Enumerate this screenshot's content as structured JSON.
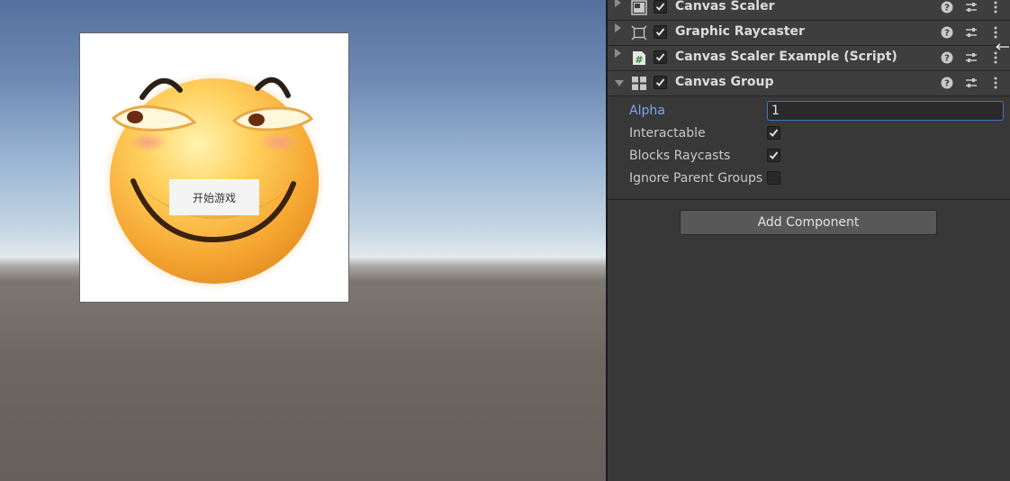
{
  "game_view": {
    "start_button_label": "开始游戏"
  },
  "inspector": {
    "components": [
      {
        "title": "Canvas Scaler",
        "enabled": true,
        "expanded": false,
        "icon": "canvas-scaler-icon"
      },
      {
        "title": "Graphic Raycaster",
        "enabled": true,
        "expanded": false,
        "icon": "raycaster-icon"
      },
      {
        "title": "Canvas Scaler Example (Script)",
        "enabled": true,
        "expanded": false,
        "icon": "script-icon"
      },
      {
        "title": "Canvas Group",
        "enabled": true,
        "expanded": true,
        "icon": "canvas-group-icon"
      }
    ],
    "canvas_group": {
      "alpha_label": "Alpha",
      "alpha_value": "1",
      "interactable_label": "Interactable",
      "interactable": true,
      "blocks_raycasts_label": "Blocks Raycasts",
      "blocks_raycasts": true,
      "ignore_parent_groups_label": "Ignore Parent Groups",
      "ignore_parent_groups": false
    },
    "add_component_label": "Add Component"
  },
  "colors": {
    "inspector_bg": "#383838",
    "header_bg": "#3e3e3e",
    "active_label": "#7ba9ef",
    "focus_border": "#3a79c4",
    "button_bg": "#585858"
  }
}
